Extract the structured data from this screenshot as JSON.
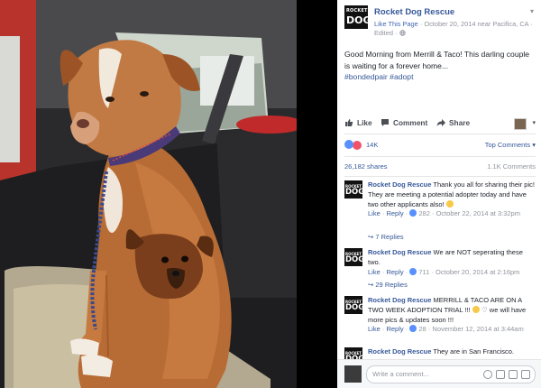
{
  "page": {
    "avatar_text_top": "ROCKET",
    "avatar_text_bottom": "DOG!",
    "name": "Rocket Dog Rescue",
    "like_this_page": "Like This Page",
    "date_location": " · October 20, 2014 near Pacifica, CA · Edited · "
  },
  "post": {
    "text": "Good Morning from Merrill & Taco! This darling couple is waiting for a forever home...",
    "hashtags": "#bondedpair #adopt"
  },
  "actions": {
    "like": "Like",
    "comment": "Comment",
    "share": "Share",
    "caret": "▾"
  },
  "reactions": {
    "count": "14K",
    "top_comments": "Top Comments ▾",
    "shares": "26,182 shares",
    "comments": "1.1K Comments"
  },
  "comments": [
    {
      "author": "Rocket Dog Rescue",
      "text": "Thank you all for sharing their pic! They are meeting a potential adopter today and have two other applicants also!",
      "like": "Like",
      "reply": "Reply",
      "likes": "282",
      "time": "October 22, 2014 at 3:32pm",
      "replies": "7 Replies"
    },
    {
      "author": "Rocket Dog Rescue",
      "text": "We are NOT seperating these two.",
      "like": "Like",
      "reply": "Reply",
      "likes": "711",
      "time": "October 20, 2014 at 2:16pm",
      "replies": "29 Replies"
    },
    {
      "author": "Rocket Dog Rescue",
      "text": "MERRILL & TACO ARE ON A TWO WEEK ADOPTION TRIAL !!!",
      "text2": "we will have more pics & updates soon !!!",
      "like": "Like",
      "reply": "Reply",
      "likes": "28",
      "time": "November 12, 2014 at 3:44am"
    },
    {
      "author": "Rocket Dog Rescue",
      "text": "They are in San Francisco."
    }
  ],
  "write_comment": {
    "placeholder": "Write a comment..."
  },
  "colors": {
    "link": "#365899",
    "like_reaction": "#5890ff",
    "love_reaction": "#f25268"
  }
}
